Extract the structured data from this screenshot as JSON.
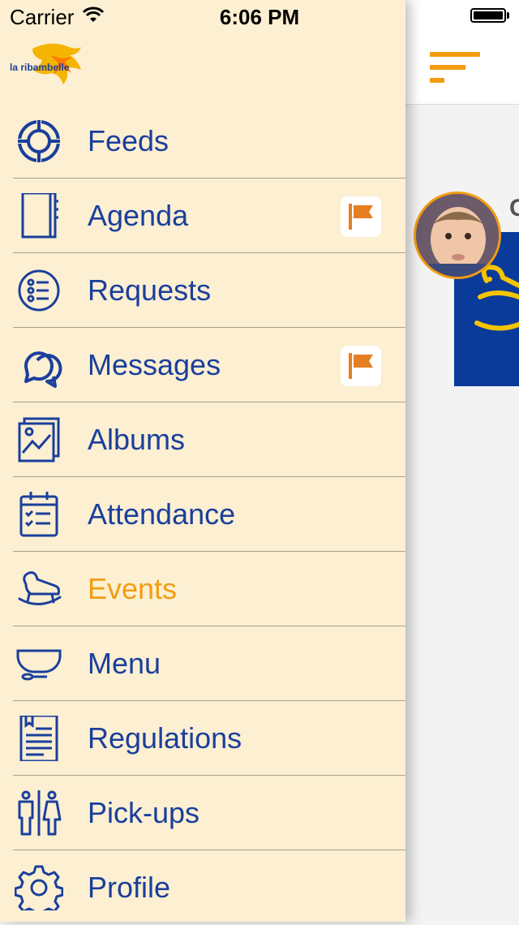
{
  "status_bar": {
    "carrier": "Carrier",
    "time": "6:06 PM"
  },
  "app": {
    "logo_text": "la ribambelle",
    "accent_color": "#f39c12",
    "primary_color": "#1a3f9c",
    "drawer_bg": "#fcefd2"
  },
  "menu": {
    "items": [
      {
        "label": "Feeds",
        "icon": "feeds-icon",
        "flag": false,
        "active": false
      },
      {
        "label": "Agenda",
        "icon": "agenda-icon",
        "flag": true,
        "active": false
      },
      {
        "label": "Requests",
        "icon": "requests-icon",
        "flag": false,
        "active": false
      },
      {
        "label": "Messages",
        "icon": "messages-icon",
        "flag": true,
        "active": false
      },
      {
        "label": "Albums",
        "icon": "albums-icon",
        "flag": false,
        "active": false
      },
      {
        "label": "Attendance",
        "icon": "attendance-icon",
        "flag": false,
        "active": false
      },
      {
        "label": "Events",
        "icon": "rocking-horse-icon",
        "flag": false,
        "active": true
      },
      {
        "label": "Menu",
        "icon": "bowl-icon",
        "flag": false,
        "active": false
      },
      {
        "label": "Regulations",
        "icon": "regulations-icon",
        "flag": false,
        "active": false
      },
      {
        "label": "Pick-ups",
        "icon": "pickups-icon",
        "flag": false,
        "active": false
      },
      {
        "label": "Profile",
        "icon": "gear-icon",
        "flag": false,
        "active": false
      }
    ]
  },
  "main": {
    "feed_author_initial": "C"
  }
}
